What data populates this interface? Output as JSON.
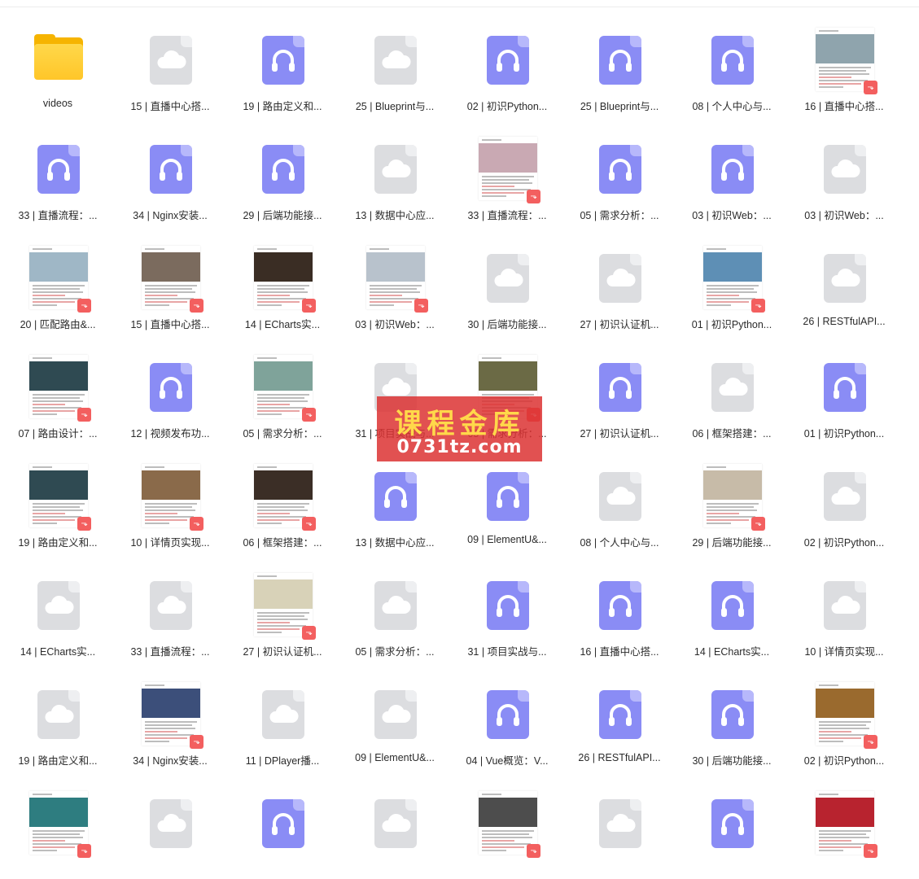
{
  "watermark": {
    "title": "课程金库",
    "site": "0731tz.com"
  },
  "files": [
    {
      "type": "folder",
      "name": "videos"
    },
    {
      "type": "cloud",
      "name": "15 | 直播中心搭..."
    },
    {
      "type": "audio",
      "name": "19 | 路由定义和..."
    },
    {
      "type": "cloud",
      "name": "25 | Blueprint与..."
    },
    {
      "type": "audio",
      "name": "02 | 初识Python..."
    },
    {
      "type": "audio",
      "name": "25 | Blueprint与..."
    },
    {
      "type": "audio",
      "name": "08 | 个人中心与..."
    },
    {
      "type": "pdf",
      "name": "16 | 直播中心搭...",
      "img": "#8fa4ad"
    },
    {
      "type": "audio",
      "name": "33 | 直播流程：..."
    },
    {
      "type": "audio",
      "name": "34 | Nginx安装..."
    },
    {
      "type": "audio",
      "name": "29 | 后端功能接..."
    },
    {
      "type": "cloud",
      "name": "13 | 数据中心应..."
    },
    {
      "type": "pdf",
      "name": "33 | 直播流程：...",
      "img": "#c9a9b3"
    },
    {
      "type": "audio",
      "name": "05 | 需求分析：..."
    },
    {
      "type": "audio",
      "name": "03 | 初识Web：..."
    },
    {
      "type": "cloud",
      "name": "03 | 初识Web：..."
    },
    {
      "type": "pdf",
      "name": "20 | 匹配路由&...",
      "img": "#9fb7c6"
    },
    {
      "type": "pdf",
      "name": "15 | 直播中心搭...",
      "img": "#7b6b5e"
    },
    {
      "type": "pdf",
      "name": "14 | ECharts实...",
      "img": "#3a2d24"
    },
    {
      "type": "pdf",
      "name": "03 | 初识Web：...",
      "img": "#b8c2cc"
    },
    {
      "type": "cloud",
      "name": "30 | 后端功能接..."
    },
    {
      "type": "cloud",
      "name": "27 | 初识认证机..."
    },
    {
      "type": "pdf",
      "name": "01 | 初识Python...",
      "img": "#5e8fb5"
    },
    {
      "type": "cloud",
      "name": "26 | RESTfulAPI..."
    },
    {
      "type": "pdf",
      "name": "07 | 路由设计：...",
      "img": "#2f4a52"
    },
    {
      "type": "audio",
      "name": "12 | 视频发布功..."
    },
    {
      "type": "pdf",
      "name": "05 | 需求分析：...",
      "img": "#7fa39a"
    },
    {
      "type": "cloud",
      "name": "31 | 项目实战与..."
    },
    {
      "type": "pdf",
      "name": "05 | 需求分析：...",
      "img": "#6b6a45"
    },
    {
      "type": "audio",
      "name": "27 | 初识认证机..."
    },
    {
      "type": "cloud",
      "name": "06 | 框架搭建：..."
    },
    {
      "type": "audio",
      "name": "01 | 初识Python..."
    },
    {
      "type": "pdf",
      "name": "19 | 路由定义和...",
      "img": "#2f4a52"
    },
    {
      "type": "pdf",
      "name": "10 | 详情页实现...",
      "img": "#8a6a4a"
    },
    {
      "type": "pdf",
      "name": "06 | 框架搭建：...",
      "img": "#3b2e26"
    },
    {
      "type": "audio",
      "name": "13 | 数据中心应..."
    },
    {
      "type": "audio",
      "name": "09 | ElementU&..."
    },
    {
      "type": "cloud",
      "name": "08 | 个人中心与..."
    },
    {
      "type": "pdf",
      "name": "29 | 后端功能接...",
      "img": "#c7bba8"
    },
    {
      "type": "cloud",
      "name": "02 | 初识Python..."
    },
    {
      "type": "cloud",
      "name": "14 | ECharts实..."
    },
    {
      "type": "cloud",
      "name": "33 | 直播流程：..."
    },
    {
      "type": "pdf",
      "name": "27 | 初识认证机...",
      "img": "#d8d2b8"
    },
    {
      "type": "cloud",
      "name": "05 | 需求分析：..."
    },
    {
      "type": "audio",
      "name": "31 | 项目实战与..."
    },
    {
      "type": "audio",
      "name": "16 | 直播中心搭..."
    },
    {
      "type": "audio",
      "name": "14 | ECharts实..."
    },
    {
      "type": "cloud",
      "name": "10 | 详情页实现..."
    },
    {
      "type": "cloud",
      "name": "19 | 路由定义和..."
    },
    {
      "type": "pdf",
      "name": "34 | Nginx安装...",
      "img": "#3c4f7a"
    },
    {
      "type": "cloud",
      "name": "11 | DPlayer播..."
    },
    {
      "type": "cloud",
      "name": "09 | ElementU&..."
    },
    {
      "type": "audio",
      "name": "04 | Vue概览：V..."
    },
    {
      "type": "audio",
      "name": "26 | RESTfulAPI..."
    },
    {
      "type": "audio",
      "name": "30 | 后端功能接..."
    },
    {
      "type": "pdf",
      "name": "02 | 初识Python...",
      "img": "#9a6a2e"
    },
    {
      "type": "pdf",
      "name": "",
      "img": "#2e7d80"
    },
    {
      "type": "cloud",
      "name": ""
    },
    {
      "type": "audio",
      "name": ""
    },
    {
      "type": "cloud",
      "name": ""
    },
    {
      "type": "pdf",
      "name": "",
      "img": "#4d4d4d"
    },
    {
      "type": "cloud",
      "name": ""
    },
    {
      "type": "audio",
      "name": ""
    },
    {
      "type": "pdf",
      "name": "",
      "img": "#b8232f"
    }
  ]
}
